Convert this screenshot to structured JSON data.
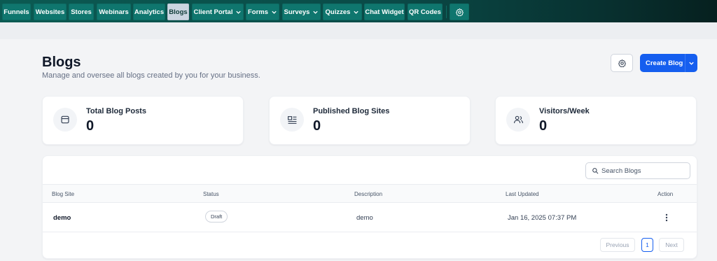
{
  "nav": {
    "tabs": [
      {
        "label": "Funnels"
      },
      {
        "label": "Websites"
      },
      {
        "label": "Stores"
      },
      {
        "label": "Webinars"
      },
      {
        "label": "Analytics"
      },
      {
        "label": "Blogs",
        "active": true
      },
      {
        "label": "Client Portal",
        "dropdown": true
      },
      {
        "label": "Forms",
        "dropdown": true
      },
      {
        "label": "Surveys",
        "dropdown": true
      },
      {
        "label": "Quizzes",
        "dropdown": true
      },
      {
        "label": "Chat Widget"
      },
      {
        "label": "QR Codes"
      }
    ],
    "settings_icon": "gear-icon"
  },
  "header": {
    "title": "Blogs",
    "subtitle": "Manage and oversee all blogs created by you for your business.",
    "create_label": "Create Blog"
  },
  "stats": [
    {
      "label": "Total Blog Posts",
      "value": "0",
      "icon": "browser-window-icon"
    },
    {
      "label": "Published Blog Sites",
      "value": "0",
      "icon": "article-layout-icon"
    },
    {
      "label": "Visitors/Week",
      "value": "0",
      "icon": "users-icon"
    }
  ],
  "table": {
    "search_placeholder": "Search Blogs",
    "columns": [
      "Blog Site",
      "Status",
      "Description",
      "Last Updated",
      "Action"
    ],
    "rows": [
      {
        "site": "demo",
        "status": "Draft",
        "description": "demo",
        "updated": "Jan 16, 2025 07:37 PM"
      }
    ]
  },
  "pagination": {
    "previous": "Previous",
    "current": "1",
    "next": "Next"
  },
  "colors": {
    "accent": "#155eef",
    "nav_tab": "#0f766e",
    "nav_active": "#cbd5e1"
  }
}
